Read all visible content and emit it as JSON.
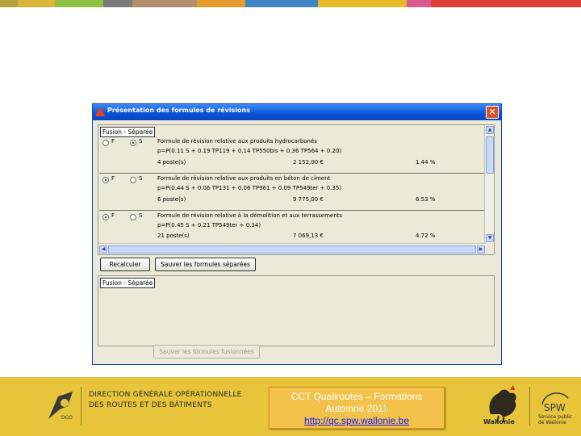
{
  "stripe": {
    "colors": [
      "#b7a23c",
      "#dbb53a",
      "#8ec13f",
      "#7b7b7b",
      "#b38f6e",
      "#e59c2e",
      "#3f83c7",
      "#e9b92c",
      "#d95b8d",
      "#e0403a"
    ]
  },
  "window": {
    "title": "Présentation des formules de révisions",
    "close_glyph": "✕",
    "panel_title": "Fusion - Séparée",
    "rows": [
      {
        "option_f": "F",
        "option_s": "S",
        "selected": "S",
        "title": "Formule de révision relative aux produits hydrocarbonés",
        "formula": "p=P(0.11 S + 0.19 TP119 + 0.14 TP550bis + 0.36 TP564 + 0.20)",
        "postes": "4 poste(s)",
        "amount": "2 152,00 €",
        "percent": "1.44 %"
      },
      {
        "option_f": "F",
        "option_s": "S",
        "selected": "F",
        "title": "Formule de révision relative aux produits en béton de ciment",
        "formula": "p=P(0.44 S + 0.06 TP131 + 0.06 TP961 + 0.09 TP549ter + 0.35)",
        "postes": "6 poste(s)",
        "amount": "9 775,00 €",
        "percent": "6.53 %"
      },
      {
        "option_f": "F",
        "option_s": "S",
        "selected": "F",
        "title": "Formule de révision relative à la démolition et aux terrassements",
        "formula": "p=P(0.45 S + 0.21 TP549ter + 0.34)",
        "postes": "21 poste(s)",
        "amount": "7 069,13 €",
        "percent": "4.72 %"
      }
    ],
    "recalculate_label": "Recalculer",
    "save_separate_label": "Sauver les formules séparées",
    "panel2_title": "Fusion - Séparée",
    "save_merged_label": "Sauver les formules fusionnées"
  },
  "footer": {
    "dgo_logo_text": "DGO",
    "dg_line1": "DIRECTION GÉNÉRALE OPÉRATIONNELLE",
    "dg_line2": "DES ROUTES ET DES BÂTIMENTS",
    "cct_line1": "CCT Qualiroutes – Formations",
    "cct_line2": "Automne 2011",
    "cct_link": "http://qc.spw.wallonie.be",
    "wallonie_label": "Wallonie",
    "spw_label": "SPW",
    "spw_sub": "Service public de Wallonie",
    "footer_color": "#e8c43a"
  }
}
